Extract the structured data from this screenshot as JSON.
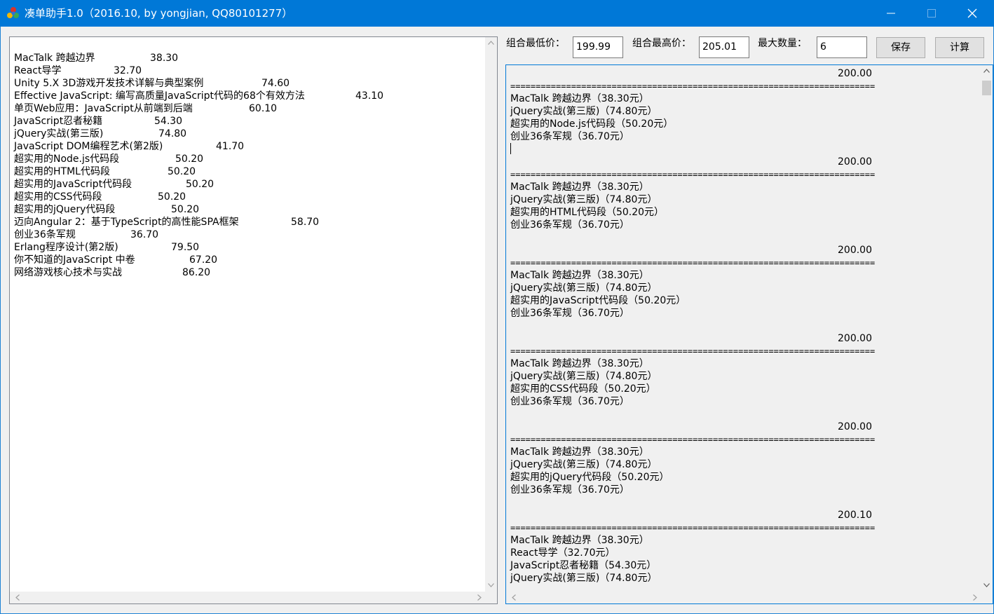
{
  "window": {
    "title": "凑单助手1.0（2016.10, by yongjian, QQ80101277）"
  },
  "controls": {
    "min_price_label": "组合最低价：",
    "min_price_value": "199.99",
    "max_price_label": "组合最高价：",
    "max_price_value": "205.01",
    "max_count_label": "最大数量：",
    "max_count_value": "6",
    "save_label": "保存",
    "calc_label": "计算"
  },
  "books": [
    {
      "name": "MacTalk 跨越边界",
      "price": "38.30"
    },
    {
      "name": "React导学",
      "price": "32.70"
    },
    {
      "name": "Unity 5.X 3D游戏开发技术详解与典型案例",
      "price": "74.60"
    },
    {
      "name": "Effective JavaScript: 编写高质量JavaScript代码的68个有效方法",
      "price": "43.10"
    },
    {
      "name": "单页Web应用：JavaScript从前端到后端",
      "price": "60.10"
    },
    {
      "name": "JavaScript忍者秘籍",
      "price": "54.30"
    },
    {
      "name": "jQuery实战(第三版)",
      "price": "74.80"
    },
    {
      "name": "JavaScript DOM编程艺术(第2版)",
      "price": "41.70"
    },
    {
      "name": "超实用的Node.js代码段",
      "price": "50.20"
    },
    {
      "name": "超实用的HTML代码段",
      "price": "50.20"
    },
    {
      "name": "超实用的JavaScript代码段",
      "price": "50.20"
    },
    {
      "name": "超实用的CSS代码段",
      "price": "50.20"
    },
    {
      "name": "超实用的jQuery代码段",
      "price": "50.20"
    },
    {
      "name": "迈向Angular 2：基于TypeScript的高性能SPA框架",
      "price": "58.70"
    },
    {
      "name": "创业36条军规",
      "price": "36.70"
    },
    {
      "name": "Erlang程序设计(第2版)",
      "price": "79.50"
    },
    {
      "name": "你不知道的JavaScript 中卷",
      "price": "67.20"
    },
    {
      "name": "网络游戏核心技术与实战",
      "price": "86.20"
    }
  ],
  "separator": "========================================================================",
  "results": [
    {
      "total": "200.00",
      "items": [
        "MacTalk 跨越边界（38.30元）",
        "jQuery实战(第三版)（74.80元）",
        "超实用的Node.js代码段（50.20元）",
        "创业36条军规（36.70元）"
      ]
    },
    {
      "total": "200.00",
      "items": [
        "MacTalk 跨越边界（38.30元）",
        "jQuery实战(第三版)（74.80元）",
        "超实用的HTML代码段（50.20元）",
        "创业36条军规（36.70元）"
      ]
    },
    {
      "total": "200.00",
      "items": [
        "MacTalk 跨越边界（38.30元）",
        "jQuery实战(第三版)（74.80元）",
        "超实用的JavaScript代码段（50.20元）",
        "创业36条军规（36.70元）"
      ]
    },
    {
      "total": "200.00",
      "items": [
        "MacTalk 跨越边界（38.30元）",
        "jQuery实战(第三版)（74.80元）",
        "超实用的CSS代码段（50.20元）",
        "创业36条军规（36.70元）"
      ]
    },
    {
      "total": "200.00",
      "items": [
        "MacTalk 跨越边界（38.30元）",
        "jQuery实战(第三版)（74.80元）",
        "超实用的jQuery代码段（50.20元）",
        "创业36条军规（36.70元）"
      ]
    },
    {
      "total": "200.10",
      "items": [
        "MacTalk 跨越边界（38.30元）",
        "React导学（32.70元）",
        "JavaScript忍者秘籍（54.30元）",
        "jQuery实战(第三版)（74.80元）"
      ]
    }
  ]
}
